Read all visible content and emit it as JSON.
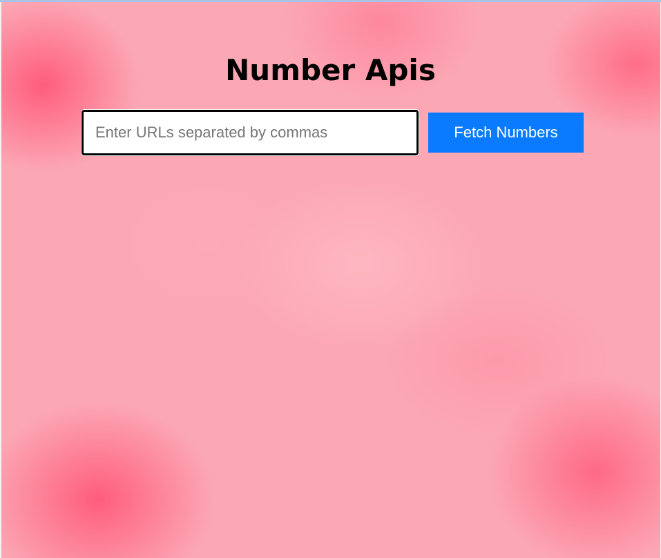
{
  "page": {
    "title": "Number Apis"
  },
  "form": {
    "url_input": {
      "value": "",
      "placeholder": "Enter URLs separated by commas"
    },
    "fetch_button_label": "Fetch Numbers"
  },
  "colors": {
    "background": "#fca7b4",
    "background_accent": "#ff5073",
    "button": "#0a7bff",
    "button_text": "#ffffff",
    "title_text": "#000000"
  }
}
